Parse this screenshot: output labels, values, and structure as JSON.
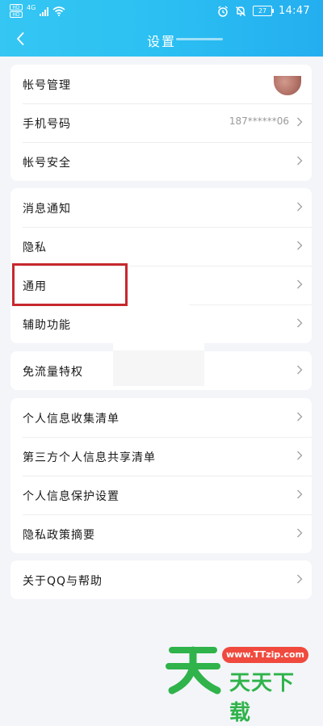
{
  "status_bar": {
    "sim_labels": [
      "HD",
      "HD"
    ],
    "network": "4G",
    "battery": "27",
    "time": "14:47"
  },
  "nav": {
    "back_icon": "chevron-left-icon",
    "title": "设置"
  },
  "groups": [
    {
      "items": [
        {
          "label": "帐号管理",
          "avatar": true
        },
        {
          "label": "手机号码",
          "value": "187******06"
        },
        {
          "label": "帐号安全"
        }
      ]
    },
    {
      "items": [
        {
          "label": "消息通知"
        },
        {
          "label": "隐私"
        },
        {
          "label": "通用",
          "highlighted": true
        },
        {
          "label": "辅助功能"
        }
      ]
    },
    {
      "items": [
        {
          "label": "免流量特权"
        }
      ]
    },
    {
      "items": [
        {
          "label": "个人信息收集清单"
        },
        {
          "label": "第三方个人信息共享清单"
        },
        {
          "label": "个人信息保护设置"
        },
        {
          "label": "隐私政策摘要"
        }
      ]
    },
    {
      "items": [
        {
          "label": "关于QQ与帮助"
        }
      ]
    }
  ],
  "watermark": {
    "url": "www.TTzip.com",
    "text": "天天下载"
  },
  "colors": {
    "header": "#2cc1f2",
    "highlight_box": "#c6282e",
    "watermark_green": "#2fb34a",
    "watermark_red": "#f04a3e"
  }
}
